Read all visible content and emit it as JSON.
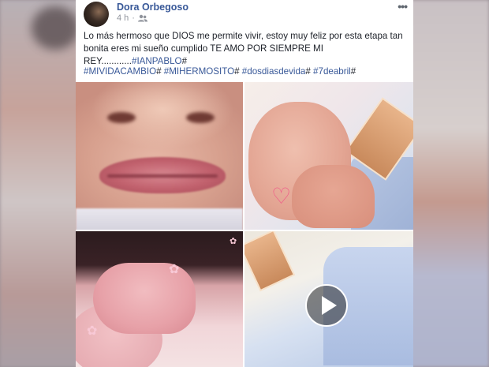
{
  "post": {
    "author": "Dora Orbegoso",
    "time": "4 h",
    "menu_label": "•••",
    "text_main": "Lo más hermoso que DIOS me permite vivir, estoy muy feliz por esta etapa tan bonita eres mi sueño cumplido TE AMO POR SIEMPRE MI REY............",
    "text_hashtag": "#IANPABLO",
    "text_tail": "#",
    "hashtags": [
      "#MIVIDACAMBIO",
      "#MIHERMOSITO",
      "#dosdiasdevida",
      "#7deabril"
    ],
    "hashtag_separator": "# "
  },
  "media": {
    "photos": [
      "baby-lips-photo",
      "baby-hand-holding-finger-photo",
      "baby-fist-photo",
      "baby-video-thumbnail"
    ],
    "video_icon": "play-icon"
  },
  "colors": {
    "link": "#385898",
    "text": "#1d2129",
    "meta": "#90949c"
  }
}
